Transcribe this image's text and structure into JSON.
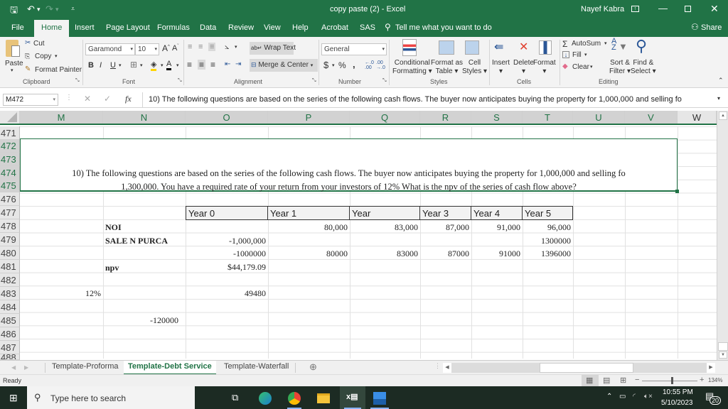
{
  "titlebar": {
    "doc_title": "copy paste (2)  -  Excel",
    "user": "Nayef Kabra",
    "icons": [
      "save-icon",
      "undo-icon",
      "redo-icon",
      "customize-qat-icon",
      "ribbon-display-icon",
      "minimize-icon",
      "restore-icon",
      "close-icon"
    ]
  },
  "ribbon_tabs": [
    "File",
    "Home",
    "Insert",
    "Page Layout",
    "Formulas",
    "Data",
    "Review",
    "View",
    "Help",
    "Acrobat",
    "SAS"
  ],
  "tell_me": "Tell me what you want to do",
  "share": "Share",
  "ribbon": {
    "clipboard": {
      "paste": "Paste",
      "cut": "Cut",
      "copy": "Copy",
      "format_painter": "Format Painter",
      "label": "Clipboard"
    },
    "font": {
      "name": "Garamond",
      "size": "10",
      "bold": "B",
      "italic": "I",
      "underline": "U",
      "label": "Font"
    },
    "alignment": {
      "wrap_text": "Wrap Text",
      "merge_center": "Merge & Center",
      "label": "Alignment"
    },
    "number": {
      "format": "General",
      "currency": "$",
      "percent": "%",
      "comma": ",",
      "label": "Number"
    },
    "styles": {
      "conditional_1": "Conditional",
      "conditional_2": "Formatting",
      "format_table_1": "Format as",
      "format_table_2": "Table",
      "cell_styles_1": "Cell",
      "cell_styles_2": "Styles",
      "label": "Styles"
    },
    "cells": {
      "insert": "Insert",
      "delete": "Delete",
      "format": "Format",
      "label": "Cells"
    },
    "editing": {
      "autosum": "AutoSum",
      "fill": "Fill",
      "clear": "Clear",
      "sort_1": "Sort &",
      "sort_2": "Filter",
      "find_1": "Find &",
      "find_2": "Select",
      "label": "Editing"
    }
  },
  "formula_bar": {
    "name_box": "M472",
    "fx": "fx",
    "content": "10) The following questions are based on the series of the following cash flows. The buyer now anticipates buying the property for 1,000,000 and selling fo"
  },
  "columns": [
    "M",
    "N",
    "O",
    "P",
    "Q",
    "R",
    "S",
    "T",
    "U",
    "V",
    "W"
  ],
  "rows": [
    "471",
    "472",
    "473",
    "474",
    "475",
    "476",
    "477",
    "478",
    "479",
    "480",
    "481",
    "482",
    "483",
    "484",
    "485",
    "486",
    "487",
    "488"
  ],
  "sheet": {
    "question_line1": "10) The following questions are based on the series of the following cash flows. The buyer now anticipates buying the property for 1,000,000 and selling fo",
    "question_line2": "1,300,000. You have a required rate of your return from your investors of 12% What is the npv of the series of cash flow above?",
    "year_headers": [
      "Year 0",
      "Year 1",
      "Year",
      "Year 3",
      "Year 4",
      "Year 5"
    ],
    "labels": {
      "noi": "NOI",
      "sale": "SALE N PURCA",
      "npv": "npv"
    },
    "noi": [
      "",
      "80,000",
      "83,000",
      "87,000",
      "91,000",
      "96,000"
    ],
    "sale": [
      "-1,000,000",
      "",
      "",
      "",
      "",
      "1300000"
    ],
    "total": [
      "-1000000",
      "80000",
      "83000",
      "87000",
      "91000",
      "1396000"
    ],
    "npv_value": "$44,179.09",
    "rate": "12%",
    "o483": "49480",
    "n485": "-120000"
  },
  "sheet_tabs": [
    {
      "label": "Template-Proforma",
      "active": false
    },
    {
      "label": "Template-Debt Service",
      "active": true
    },
    {
      "label": "Template-Waterfall",
      "active": false
    }
  ],
  "status": {
    "ready": "Ready",
    "zoom": "134%"
  },
  "taskbar": {
    "search_placeholder": "Type here to search",
    "time": "10:55 PM",
    "date": "5/10/2023",
    "notifications": "20"
  }
}
